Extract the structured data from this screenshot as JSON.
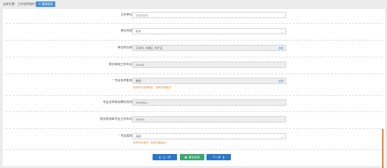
{
  "breadcrumb": {
    "text": "当前位置：工作程序维护"
  },
  "header": {
    "button_label": "基础信息"
  },
  "form": {
    "fields": [
      {
        "label": "工作单位",
        "value": "",
        "required": false
      },
      {
        "label": "单位性质",
        "value": "机关",
        "required": false
      },
      {
        "label": "单位所在地",
        "value": "天津市_市辖区_和平区",
        "action": "选择",
        "required": false
      },
      {
        "label": "首次参加工作年月",
        "value": "201901",
        "required": false
      },
      {
        "label": "专业技术职务",
        "value": "教授",
        "action": "选择",
        "hint": "如何专业技术职务，没有的请留空!",
        "required": true
      },
      {
        "label": "专业技术职务聘任时间",
        "value": "20180914",
        "required": false
      },
      {
        "label": "首次参加本专业工作年月",
        "value": "202001",
        "required": false
      },
      {
        "label": "专业类别",
        "value": "请选",
        "hint": "没有专业类别，没有的请留空!",
        "required": true
      }
    ]
  },
  "buttons": {
    "prev": "上一步",
    "save": "保存信息",
    "next": "下一步"
  }
}
